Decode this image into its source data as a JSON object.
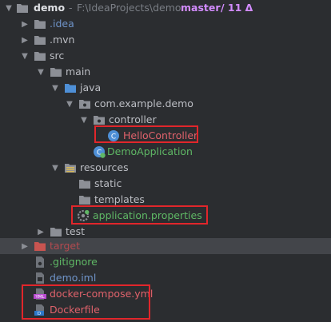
{
  "tree": {
    "root": {
      "name": "demo",
      "path": "F:\\IdeaProjects\\demo",
      "branch": "master",
      "changes": "/ 11 Δ"
    },
    "items": [
      {
        "label": "",
        "name": ".idea"
      },
      {
        "name": ".mvn"
      },
      {
        "name": "src"
      },
      {
        "name": "main"
      },
      {
        "name": "java"
      },
      {
        "name": "com.example.demo"
      },
      {
        "name": "controller"
      },
      {
        "name": "HelloController"
      },
      {
        "name": "DemoApplication"
      },
      {
        "name": "resources"
      },
      {
        "name": "static"
      },
      {
        "name": "templates"
      },
      {
        "name": "application.properties"
      },
      {
        "name": "test"
      },
      {
        "name": "target"
      },
      {
        "name": ".gitignore"
      },
      {
        "name": "demo.iml"
      },
      {
        "name": "docker-compose.yml"
      },
      {
        "name": "Dockerfile"
      }
    ]
  },
  "colors": {
    "background": "#2b2d30",
    "selected_row": "#43454a",
    "highlight_box": "#e1262b",
    "untracked_red": "#e0626b",
    "added_green": "#5fb865",
    "branch_purple": "#d38cff"
  },
  "icons": {
    "expanded": "chevron-down-icon",
    "collapsed": "chevron-right-icon",
    "folder": "folder-icon",
    "source_folder": "source-folder-icon",
    "package": "package-icon",
    "class": "class-icon",
    "spring_app": "spring-boot-class-icon",
    "resources_folder": "resources-folder-icon",
    "properties": "spring-properties-icon",
    "excluded_folder": "excluded-folder-icon",
    "gitignore": "gitignore-file-icon",
    "iml": "iml-file-icon",
    "yaml": "yaml-file-icon",
    "docker": "docker-file-icon"
  }
}
